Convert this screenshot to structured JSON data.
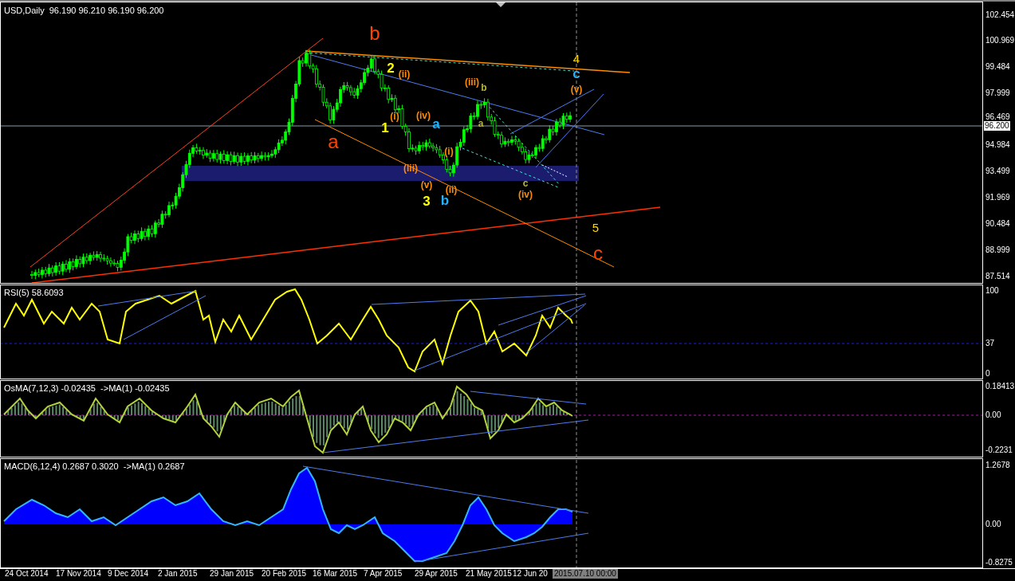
{
  "header": {
    "symbol": "USD,Daily",
    "quote": "96.190 96.210 96.190 96.200"
  },
  "price_axis": {
    "labels": [
      "102.454",
      "100.969",
      "99.484",
      "97.999",
      "96.469",
      "94.984",
      "93.499",
      "91.969",
      "90.484",
      "88.999",
      "87.514"
    ],
    "current_price": "96.200"
  },
  "wave_labels": [
    {
      "text": "a",
      "color": "#ff4500",
      "kind": "major"
    },
    {
      "text": "b",
      "color": "#ff4500",
      "kind": "major"
    },
    {
      "text": "1",
      "color": "#ffff00",
      "kind": "minor"
    },
    {
      "text": "2",
      "color": "#ffff00",
      "kind": "minor"
    },
    {
      "text": "(i)",
      "color": "#ff8c00",
      "kind": "sub"
    },
    {
      "text": "(ii)",
      "color": "#ff8c00",
      "kind": "sub"
    },
    {
      "text": "(iii)",
      "color": "#ff8c00",
      "kind": "sub"
    },
    {
      "text": "(iv)",
      "color": "#ff8c00",
      "kind": "sub"
    },
    {
      "text": "(v)",
      "color": "#ff8c00",
      "kind": "sub"
    },
    {
      "text": "3",
      "color": "#ffff00",
      "kind": "minor"
    },
    {
      "text": "a",
      "color": "#1eb4ff",
      "kind": "minor"
    },
    {
      "text": "(i)",
      "color": "#ff8c00",
      "kind": "sub"
    },
    {
      "text": "b",
      "color": "#1eb4ff",
      "kind": "minor"
    },
    {
      "text": "(ii)",
      "color": "#ff8c00",
      "kind": "sub"
    },
    {
      "text": "(iii)",
      "color": "#ff8c00",
      "kind": "sub"
    },
    {
      "text": "a",
      "color": "#b5b535",
      "kind": "sub"
    },
    {
      "text": "b",
      "color": "#b5b535",
      "kind": "sub"
    },
    {
      "text": "c",
      "color": "#b5b535",
      "kind": "sub"
    },
    {
      "text": "(iv)",
      "color": "#ff8c00",
      "kind": "sub"
    },
    {
      "text": "4",
      "color": "#ffd700",
      "kind": "thin"
    },
    {
      "text": "c",
      "color": "#1eb4ff",
      "kind": "minor"
    },
    {
      "text": "(v)",
      "color": "#ff8c00",
      "kind": "sub"
    },
    {
      "text": "5",
      "color": "#ffd700",
      "kind": "thin"
    },
    {
      "text": "c",
      "color": "#ff4500",
      "kind": "major"
    }
  ],
  "panes": [
    {
      "kind": "rsi",
      "title": "RSI(5) 58.6093",
      "axis": [
        "100",
        "37",
        "0"
      ]
    },
    {
      "kind": "osma",
      "title": "OsMA(7,12,3) -0.02435  ->MA(1) -0.02435",
      "axis": [
        "0.18413",
        "0.00",
        "-0.2231"
      ]
    },
    {
      "kind": "macd",
      "title": "MACD(6,12,4) 0.2687 0.3020  ->MA(1) 0.2687",
      "axis": [
        "1.2678",
        "0.00",
        "-0.8275"
      ]
    }
  ],
  "time_axis": {
    "labels": [
      "24 Oct 2014",
      "17 Nov 2014",
      "9 Dec 2014",
      "2 Jan 2015",
      "29 Jan 2015",
      "20 Feb 2015",
      "16 Mar 2015",
      "7 Apr 2015",
      "29 Apr 2015",
      "21 May 2015",
      "12 Jun 20"
    ],
    "cursor_time": "2015.07.10 00:00"
  }
}
